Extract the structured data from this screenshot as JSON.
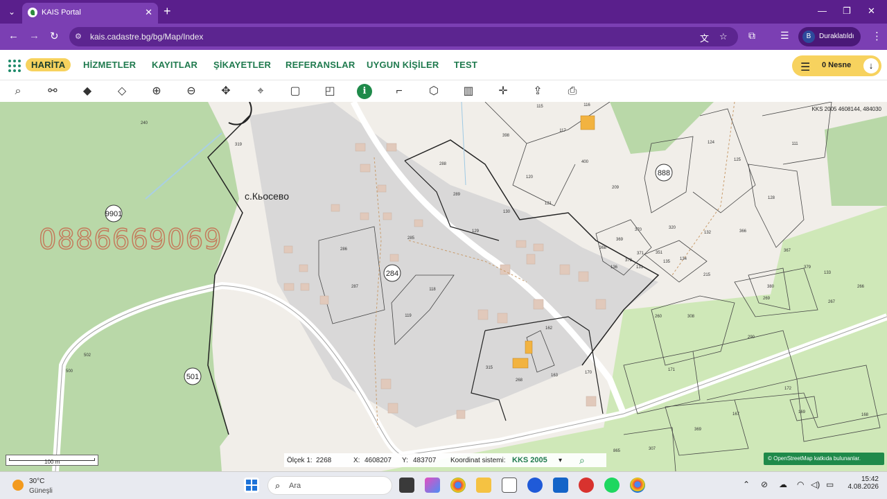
{
  "browser": {
    "tab_title": "KAIS Portal",
    "url": "kais.cadastre.bg/bg/Map/Index",
    "profile_initial": "B",
    "profile_status": "Duraklatıldı"
  },
  "app_nav": {
    "items": [
      "HARİTA",
      "HİZMETLER",
      "KAYITLAR",
      "ŞİKAYETLER",
      "REFERANSLAR",
      "UYGUN KİŞİLER",
      "TEST"
    ],
    "selection_count": "0 Nesne"
  },
  "map": {
    "top_coordinates": "KKS 2005 4608144, 484030",
    "village_label": "с.Кьосево",
    "watermark_phone": "0886669069",
    "parcel_labels": [
      "240",
      "319",
      "115",
      "116",
      "117",
      "398",
      "288",
      "289",
      "120",
      "121",
      "400",
      "209",
      "124",
      "125",
      "111",
      "128",
      "500",
      "502",
      "888",
      "9901",
      "284",
      "285",
      "286",
      "287",
      "118",
      "119",
      "129",
      "130",
      "320",
      "132",
      "366",
      "367",
      "368",
      "369",
      "370",
      "371",
      "372",
      "136",
      "131",
      "351",
      "135",
      "134",
      "215",
      "379",
      "133",
      "266",
      "380",
      "269",
      "267",
      "260",
      "308",
      "290",
      "162",
      "315",
      "268",
      "163",
      "170",
      "171",
      "172",
      "169",
      "168",
      "167",
      "369",
      "307",
      "865",
      "501"
    ],
    "scale_label": "100 m",
    "osm_attribution": "© OpenStreetMap  katkıda bulunanlar."
  },
  "status": {
    "scale_label": "Ölçek 1:",
    "scale_value": "2268",
    "x_label": "X:",
    "x_value": "4608207",
    "y_label": "Y:",
    "y_value": "483707",
    "crs_label": "Koordinat sistemi:",
    "crs_value": "KKS 2005"
  },
  "taskbar": {
    "temperature": "30°C",
    "weather": "Güneşli",
    "search_label": "Ara",
    "time": "15:42",
    "date": "4.08.2026"
  }
}
